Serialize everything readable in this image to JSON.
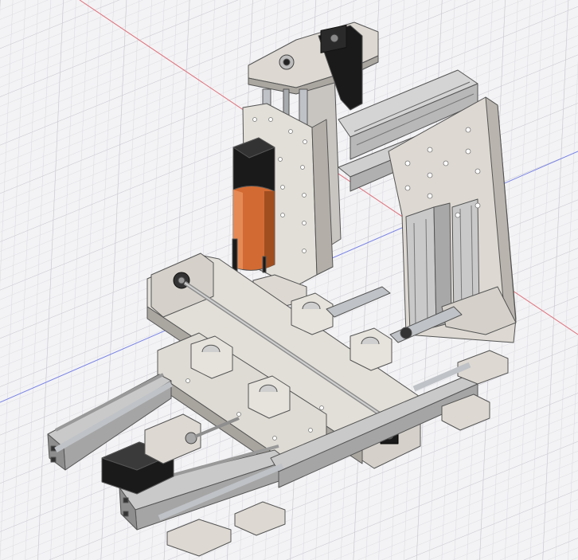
{
  "viewport": {
    "background": "#f3f3f5",
    "grid_minor": "#dcdce2",
    "grid_major": "#c6c6ce",
    "axis_x_color": "#e0707a",
    "axis_y_color": "#7a84e6"
  },
  "model": {
    "aluminum": "#c4c4c4",
    "aluminum_light": "#e2e2e2",
    "aluminum_dark": "#8e8e8e",
    "plate": "#ddd9d2",
    "plate_light": "#ece9e3",
    "plate_dark": "#aaa6a0",
    "rod": "#bfc2c6",
    "spindle": "#d26b33",
    "spindle_dark": "#a04e20",
    "motor": "#1a1a1a",
    "motor_face": "#3a3a3a",
    "outline": "#555555"
  }
}
